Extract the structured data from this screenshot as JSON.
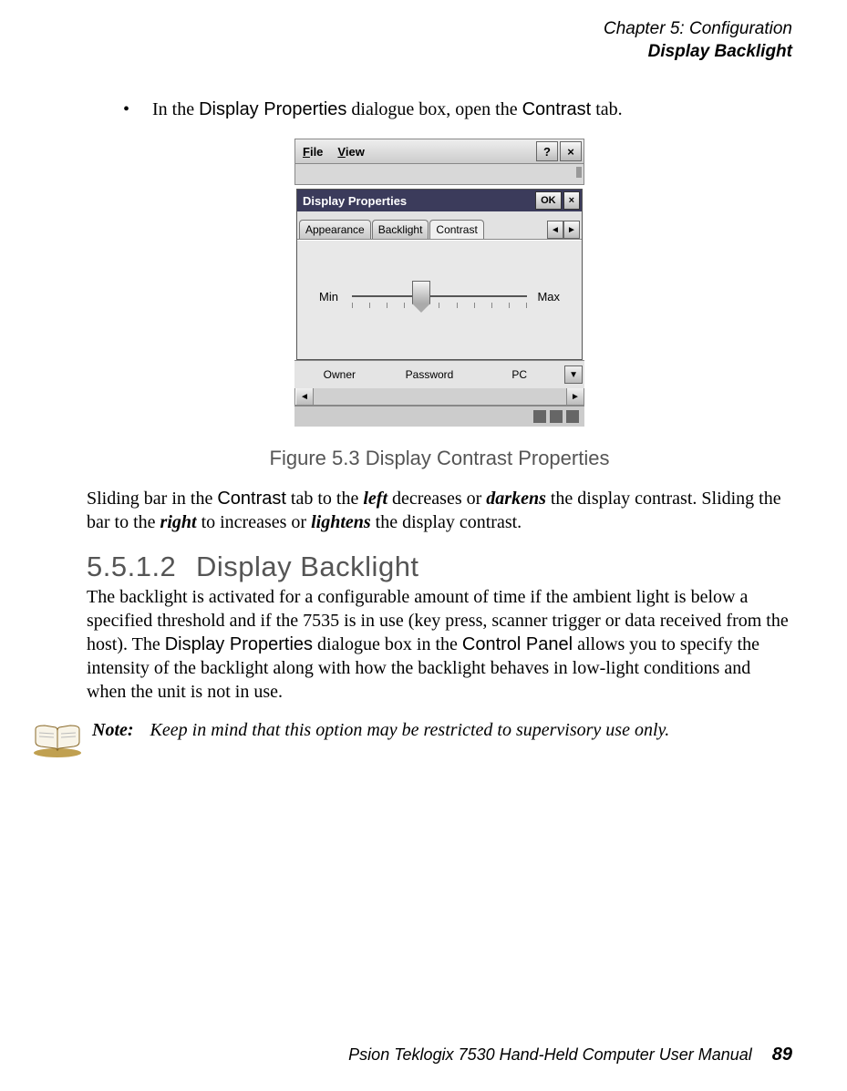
{
  "header": {
    "chapter": "Chapter 5: Configuration",
    "section": "Display Backlight"
  },
  "bullet": {
    "prefix": "In the ",
    "dp": "Display Properties",
    "mid": " dialogue box, open the ",
    "ct": "Contrast",
    "suffix": " tab."
  },
  "screenshot": {
    "menu": {
      "file": "File",
      "view": "View",
      "help": "?",
      "close": "×"
    },
    "dialog": {
      "title": "Display Properties",
      "ok": "OK",
      "close": "×",
      "tabs": {
        "appearance": "Appearance",
        "backlight": "Backlight",
        "contrast": "Contrast"
      },
      "arrows": {
        "left": "◄",
        "right": "►"
      },
      "min": "Min",
      "max": "Max"
    },
    "bottom": {
      "owner": "Owner",
      "password": "Password",
      "pc": "PC",
      "drop": "▼"
    },
    "hscroll": {
      "left": "◄",
      "right": "►"
    }
  },
  "figcaption": "Figure 5.3 Display Contrast Properties",
  "para1": {
    "t1": "Sliding bar in the ",
    "contrast": "Contrast",
    "t2": " tab to the ",
    "left": "left",
    "t3": " decreases or ",
    "darkens": "darkens",
    "t4": " the display contrast. Sliding the bar to the ",
    "right": "right",
    "t5": " to increases or ",
    "lightens": "lightens",
    "t6": " the display contrast."
  },
  "heading": {
    "num": "5.5.1.2",
    "title": "Display Backlight"
  },
  "para2": {
    "t1": "The backlight is activated for a configurable amount of time if the ambient light is below a specified threshold and if the 7535 is in use (key press, scanner trigger or data received from the host). The ",
    "dp": "Display Properties",
    "t2": " dialogue box in the ",
    "cp": "Control Panel",
    "t3": " allows you to specify the intensity of the backlight along with how the backlight behaves in low-light conditions and when the unit is not in use."
  },
  "note": {
    "label": "Note:",
    "text": "Keep in mind that this option may be restricted to supervisory use only."
  },
  "footer": {
    "text": "Psion Teklogix 7530 Hand-Held Computer User Manual",
    "page": "89"
  }
}
